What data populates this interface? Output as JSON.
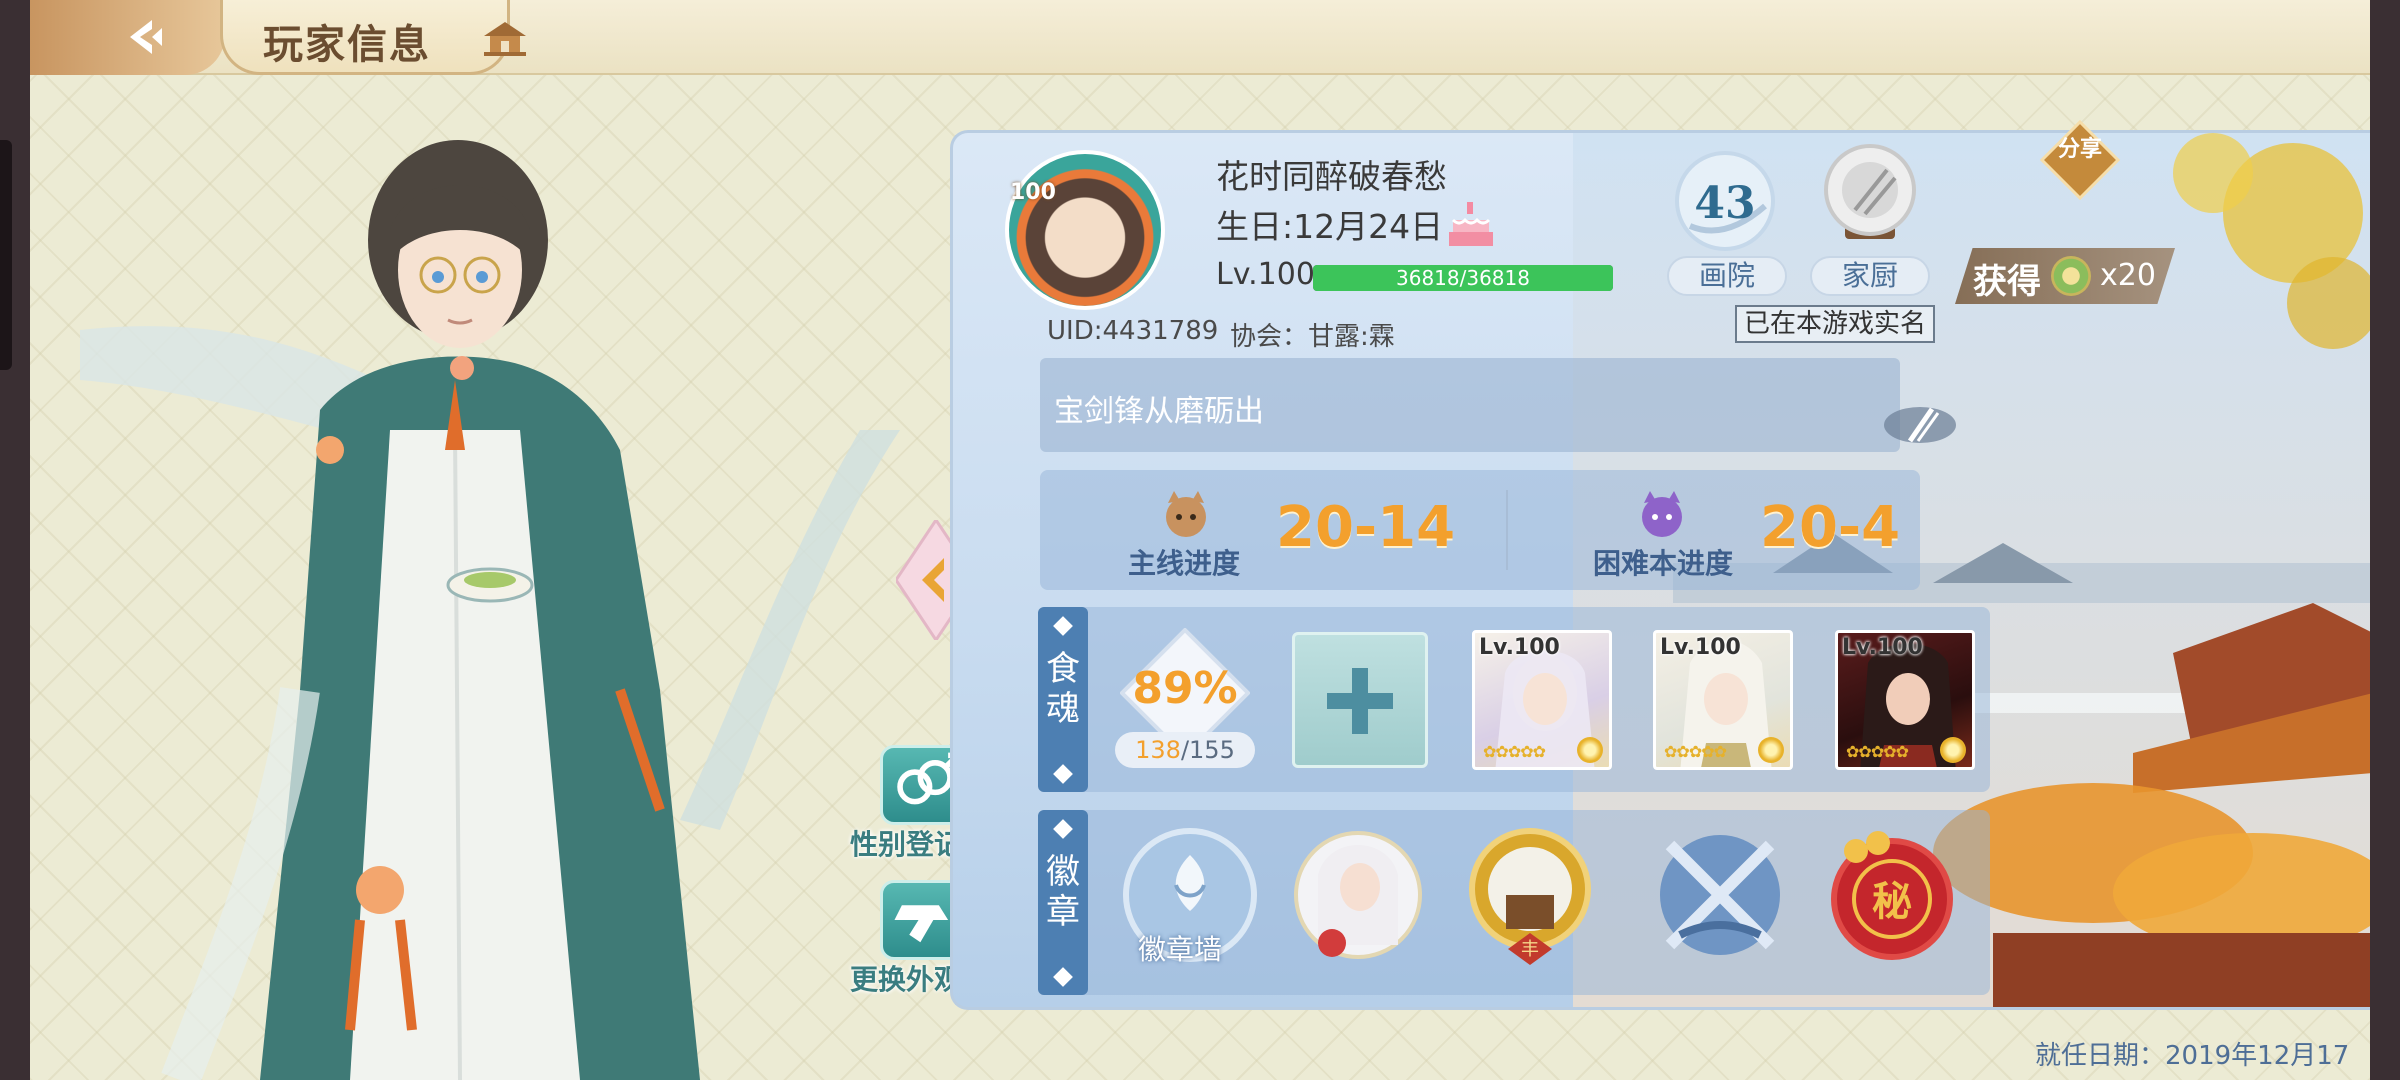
{
  "header": {
    "title": "玩家信息",
    "back_icon": "back-arrow-icon",
    "home_icon": "house-icon"
  },
  "player": {
    "name": "花时同醉破春愁",
    "birthday": "生日:12月24日",
    "level": "Lv.100",
    "avatar_level": "100",
    "exp_text": "36818/36818",
    "exp_fraction": 1.0,
    "uid": "UID:4431789",
    "guild": "协会：甘露:霖",
    "signature": "宝剑锋从磨砺出",
    "realname_notice": "已在本游戏实名",
    "appointment_date": "就任日期：2019年12月17日"
  },
  "stats": {
    "gallery_count": "43",
    "gallery_label": "画院",
    "kitchen_label": "家厨"
  },
  "share": {
    "label": "分享",
    "obtain_label": "获得",
    "reward_count": "x20"
  },
  "progress": {
    "main_label": "主线进度",
    "main_value": "20-14",
    "hard_label": "困难本进度",
    "hard_value": "20-4"
  },
  "food_souls": {
    "tag": "食魂",
    "percent": "89%",
    "owned": "138",
    "total": "/155",
    "slots": [
      {
        "level": "Lv.100",
        "stars": "✿✿✿✿✿"
      },
      {
        "level": "Lv.100",
        "stars": "✿✿✿✿✿"
      },
      {
        "level": "Lv.100",
        "stars": "✿✿✿✿✿"
      }
    ]
  },
  "badges": {
    "tag": "徽章",
    "wall_label": "徽章墙",
    "seal_char": "秘",
    "plaque_char": "丰"
  },
  "side_buttons": {
    "gender_label": "性别登记",
    "outfit_label": "更换外观"
  },
  "colors": {
    "accent_orange": "#f3a02d",
    "exp_green": "#3cc45a",
    "tag_blue": "#4d7fb2"
  }
}
